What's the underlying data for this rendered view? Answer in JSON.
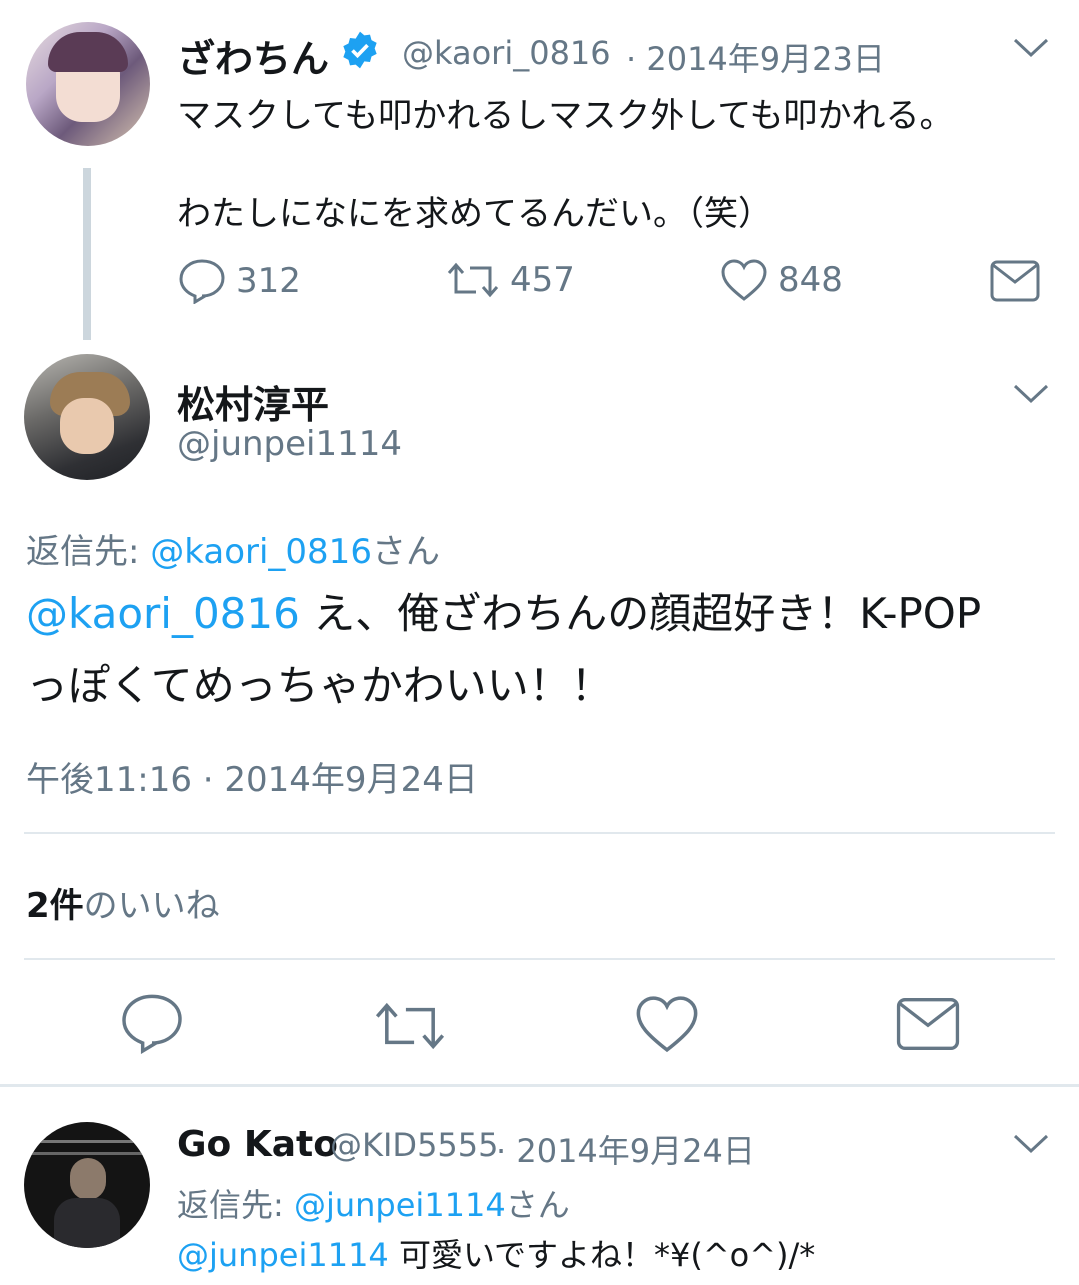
{
  "tweet1": {
    "name": "ざわちん",
    "handle": "@kaori_0816",
    "date": "· 2014年9月23日",
    "line1": "マスクしても叩かれるしマスク外しても叩かれる。",
    "line2": "わたしになにを求めてるんだい。（笑）",
    "replies": "312",
    "retweets": "457",
    "likes": "848"
  },
  "tweet2": {
    "name": "松村淳平",
    "handle": "@junpei1114",
    "reply_prefix": "返信先: ",
    "reply_to": "@kaori_0816",
    "reply_suffix": "さん",
    "mention": "@kaori_0816",
    "text1": " え、俺ざわちんの顔超好き！K-POP",
    "text2": "っぽくてめっちゃかわいい！！",
    "timestamp": "午後11:16 · 2014年9月24日",
    "likes_count": "2件",
    "likes_label": "のいいね"
  },
  "tweet3": {
    "name": "Go Kato",
    "handle": "@KID5555",
    "date": "· 2014年9月24日",
    "reply_prefix": "返信先: ",
    "reply_to": "@junpei1114",
    "reply_suffix": "さん",
    "mention": "@junpei1114",
    "text": " 可愛いですよね！*¥(^o^)/*"
  },
  "colors": {
    "accent": "#1da1f2",
    "muted": "#657786",
    "verified": "#1da1f2"
  }
}
